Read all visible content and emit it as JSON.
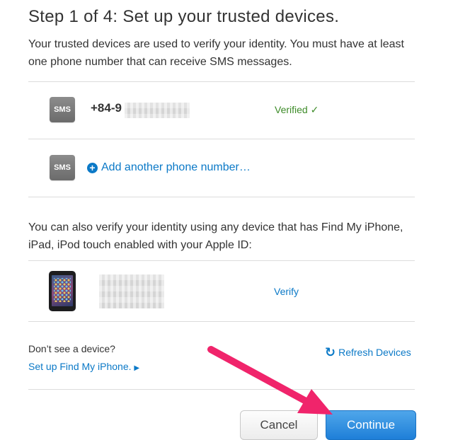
{
  "header": {
    "title": "Step 1 of 4: Set up your trusted devices."
  },
  "intro": {
    "text": "Your trusted devices are used to verify your identity. You must have at least one phone number that can receive SMS messages."
  },
  "phone_row": {
    "badge": "SMS",
    "number": "+84-9",
    "status": "Verified",
    "status_icon": "check-icon"
  },
  "add_row": {
    "badge": "SMS",
    "link": "Add another phone number…",
    "icon": "plus-circle-icon"
  },
  "find_my": {
    "text": "You can also verify your identity using any device that has Find My iPhone, iPad, iPod touch enabled with your Apple ID:"
  },
  "device_row": {
    "action": "Verify",
    "icon": "ipad-icon"
  },
  "footer": {
    "no_device": "Don’t see a device?",
    "setup_link": "Set up Find My iPhone.",
    "refresh": "Refresh Devices",
    "cancel": "Cancel",
    "continue": "Continue"
  },
  "colors": {
    "accent": "#0b79c7",
    "verified": "#3d8b28",
    "arrow": "#f0246b"
  }
}
